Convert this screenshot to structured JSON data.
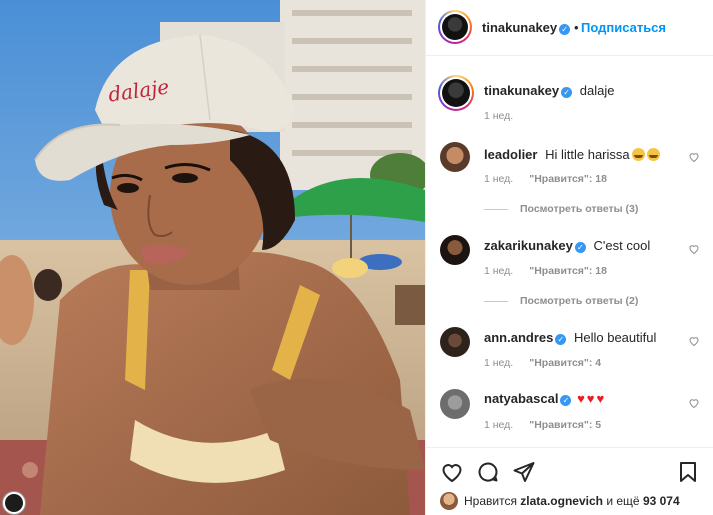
{
  "photo": {
    "cap_text": "dalaje"
  },
  "post": {
    "author": "tinakunakey",
    "follow_label": "Подписаться",
    "separator": "•"
  },
  "caption": {
    "author": "tinakunakey",
    "text": "dalaje",
    "time": "1 нед."
  },
  "comments": [
    {
      "author": "leadolier",
      "text": "Hi little harissa",
      "time": "1 нед.",
      "likes": "\"Нравится\": 18",
      "replies": "Посмотреть ответы (3)",
      "verified": false
    },
    {
      "author": "zakarikunakey",
      "text": "C'est cool",
      "time": "1 нед.",
      "likes": "\"Нравится\": 18",
      "replies": "Посмотреть ответы (2)",
      "verified": true
    },
    {
      "author": "ann.andres",
      "text": "Hello beautiful",
      "time": "1 нед.",
      "likes": "\"Нравится\": 4",
      "verified": true
    },
    {
      "author": "natyabascal",
      "text": "",
      "time": "1 нед.",
      "likes": "\"Нравится\": 5",
      "verified": true
    }
  ],
  "liked_by": {
    "prefix": "Нравится",
    "user": "zlata.ognevich",
    "middle": "и ещё",
    "count": "93 074"
  },
  "icons": {
    "like": "heart-icon",
    "comment": "comment-bubble-icon",
    "share": "paper-plane-icon",
    "save": "bookmark-icon",
    "verified": "verified-badge-icon"
  },
  "colors": {
    "link": "#0095f6",
    "verified": "#3897f0",
    "text": "#262626",
    "muted": "#8e8e8e"
  }
}
